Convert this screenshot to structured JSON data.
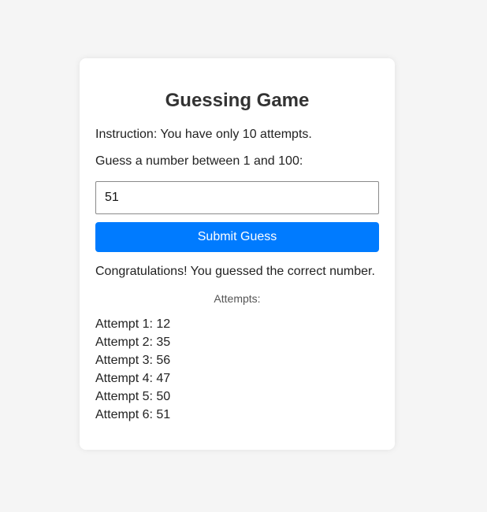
{
  "game": {
    "title": "Guessing Game",
    "instruction": "Instruction: You have only 10 attempts.",
    "prompt": "Guess a number between 1 and 100:",
    "input_value": "51",
    "submit_label": "Submit Guess",
    "message": "Congratulations! You guessed the correct number.",
    "attempts_heading": "Attempts:",
    "attempts": [
      "Attempt 1: 12",
      "Attempt 2: 35",
      "Attempt 3: 56",
      "Attempt 4: 47",
      "Attempt 5: 50",
      "Attempt 6: 51"
    ]
  },
  "colors": {
    "page_background": "#f5f5f5",
    "card_background": "#ffffff",
    "button_accent": "#007bff"
  }
}
